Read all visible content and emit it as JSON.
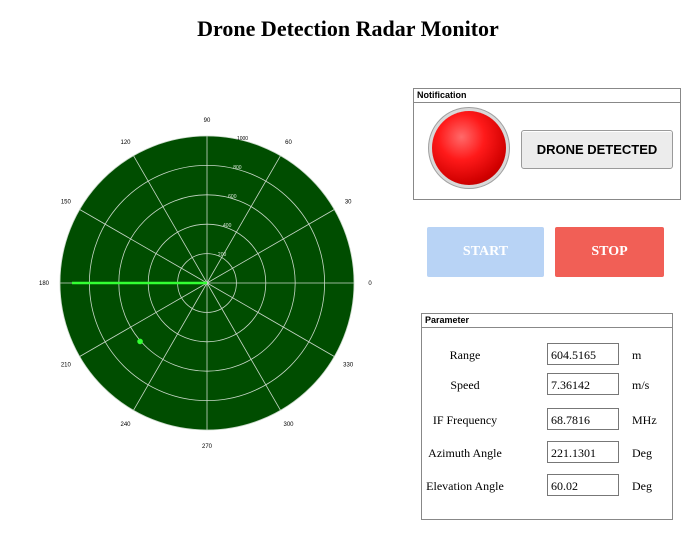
{
  "title": "Drone Detection Radar Monitor",
  "radar": {
    "angle_labels": [
      "0",
      "30",
      "60",
      "90",
      "120",
      "150",
      "180",
      "210",
      "240",
      "270",
      "300",
      "330"
    ],
    "range_labels": [
      "1000",
      "800",
      "600",
      "400",
      "200"
    ],
    "sweep_angle_deg": 180,
    "target": {
      "range_m": 604.5165,
      "azimuth_deg": 221.1301
    },
    "colors": {
      "background": "#004d00",
      "grid": "#c8d8c8",
      "sweep": "#33ff33",
      "target": "#33ff33"
    }
  },
  "notification": {
    "title": "Notification",
    "status_label": "DRONE DETECTED",
    "lamp_color": "#ff1a1a"
  },
  "controls": {
    "start_label": "START",
    "stop_label": "STOP",
    "start_color": "#b8d3f5",
    "stop_color": "#f15f56"
  },
  "parameters": {
    "title": "Parameter",
    "rows": [
      {
        "label": "Range",
        "value": "604.5165",
        "unit": "m"
      },
      {
        "label": "Speed",
        "value": "7.36142",
        "unit": "m/s"
      },
      {
        "label": "IF Frequency",
        "value": "68.7816",
        "unit": "MHz"
      },
      {
        "label": "Azimuth Angle",
        "value": "221.1301",
        "unit": "Deg"
      },
      {
        "label": "Elevation Angle",
        "value": "60.02",
        "unit": "Deg"
      }
    ]
  }
}
